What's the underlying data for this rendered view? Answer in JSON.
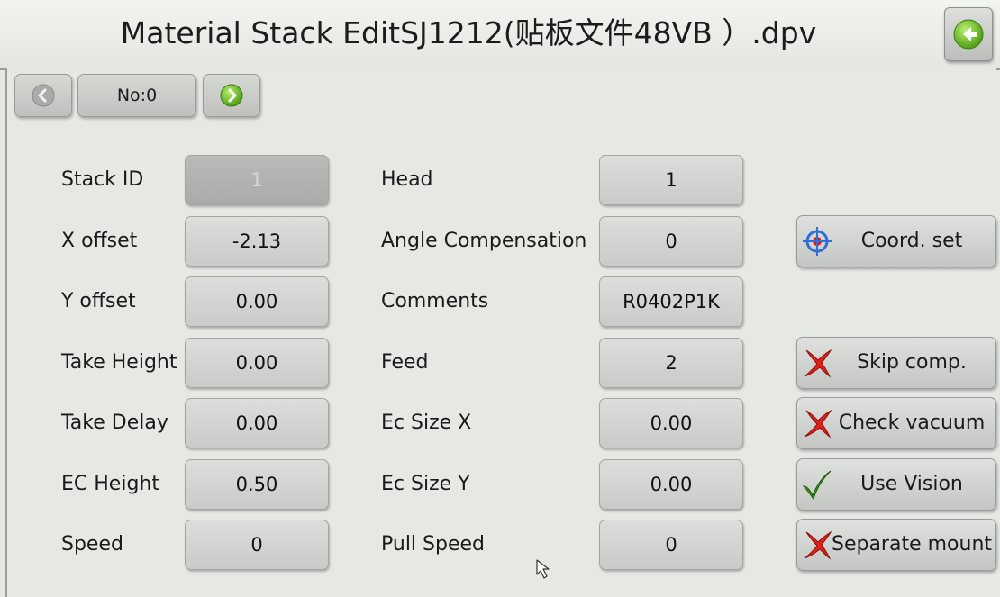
{
  "window": {
    "title": "Material Stack EditSJ1212(贴板文件48VB ）.dpv"
  },
  "nav": {
    "record_label": "No:0"
  },
  "params": [
    {
      "label": "Stack ID",
      "value": "1"
    },
    {
      "label": "X offset",
      "value": "-2.13"
    },
    {
      "label": "Y offset",
      "value": "0.00"
    },
    {
      "label": "Take Height",
      "value": "0.00"
    },
    {
      "label": "Take Delay",
      "value": "0.00"
    },
    {
      "label": "EC Height",
      "value": "0.50"
    },
    {
      "label": "Speed",
      "value": "0"
    },
    {
      "label": "Head",
      "value": "1"
    },
    {
      "label": "Angle Compensation",
      "value": "0"
    },
    {
      "label": "Comments",
      "value": "R0402P1K"
    },
    {
      "label": "Feed",
      "value": "2"
    },
    {
      "label": "Ec Size X",
      "value": "0.00"
    },
    {
      "label": "Ec Size Y",
      "value": "0.00"
    },
    {
      "label": "Pull Speed",
      "value": "0"
    }
  ],
  "actions": {
    "coord_set": {
      "label": "Coord. set",
      "icon": "crosshair-icon"
    },
    "skip_comp": {
      "label": "Skip comp.",
      "icon": "red-x-icon",
      "state": "off"
    },
    "check_vacuum": {
      "label": "Check vacuum",
      "icon": "red-x-icon",
      "state": "off"
    },
    "use_vision": {
      "label": "Use Vision",
      "icon": "green-check-icon",
      "state": "on"
    },
    "separate_mount": {
      "label": "Separate mount",
      "icon": "red-x-icon",
      "state": "off"
    }
  },
  "colors": {
    "background": "#e6e8e4",
    "field": "#cfd1ce",
    "field_disabled": "#b0b2af",
    "accent_green": "#6cbf1a",
    "x_red": "#e0201a",
    "check_green": "#3a9a1a"
  }
}
